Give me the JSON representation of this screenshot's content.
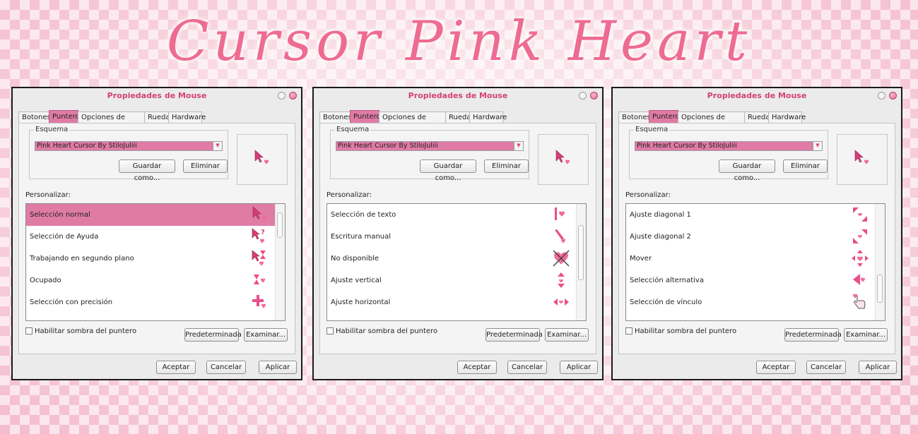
{
  "banner": {
    "title": "Cursor Pink Heart"
  },
  "colors": {
    "accent": "#e07ba6",
    "title_text": "#d4417a",
    "heart": "#e94e8b"
  },
  "dialogs": [
    {
      "title": "Propiedades de Mouse",
      "tabs": [
        "Botones",
        "Punteros",
        "Opciones de puntero",
        "Rueda",
        "Hardware"
      ],
      "active_tab": "Punteros",
      "scheme": {
        "label": "Esquema",
        "value": "Pink Heart Cursor By StiloJuliii",
        "save_as": "Guardar como...",
        "delete": "Eliminar"
      },
      "customize_label": "Personalizar:",
      "list": [
        {
          "label": "Selección normal",
          "icon": "arrow-heart-icon",
          "selected": true
        },
        {
          "label": "Selección de Ayuda",
          "icon": "help-arrow-heart-icon",
          "selected": false
        },
        {
          "label": "Trabajando en segundo plano",
          "icon": "busy-arrow-heart-icon",
          "selected": false
        },
        {
          "label": "Ocupado",
          "icon": "hourglass-heart-icon",
          "selected": false
        },
        {
          "label": "Selección con precisión",
          "icon": "crosshair-heart-icon",
          "selected": false
        }
      ],
      "shadow_label": "Habilitar sombra del puntero",
      "default_button": "Predeterminada",
      "browse_button": "Examinar...",
      "ok": "Aceptar",
      "cancel": "Cancelar",
      "apply": "Aplicar"
    },
    {
      "title": "Propiedades de Mouse",
      "tabs": [
        "Botones",
        "Punteros",
        "Opciones de puntero",
        "Rueda",
        "Hardware"
      ],
      "active_tab": "Punteros",
      "scheme": {
        "label": "Esquema",
        "value": "Pink Heart Cursor By StiloJuliii",
        "save_as": "Guardar como...",
        "delete": "Eliminar"
      },
      "customize_label": "Personalizar:",
      "list": [
        {
          "label": "Selección de texto",
          "icon": "text-beam-heart-icon",
          "selected": false
        },
        {
          "label": "Escritura manual",
          "icon": "pen-heart-icon",
          "selected": false
        },
        {
          "label": "No disponible",
          "icon": "unavailable-heart-icon",
          "selected": false
        },
        {
          "label": "Ajuste vertical",
          "icon": "resize-vertical-icon",
          "selected": false
        },
        {
          "label": "Ajuste horizontal",
          "icon": "resize-horizontal-icon",
          "selected": false
        }
      ],
      "shadow_label": "Habilitar sombra del puntero",
      "default_button": "Predeterminada",
      "browse_button": "Examinar...",
      "ok": "Aceptar",
      "cancel": "Cancelar",
      "apply": "Aplicar"
    },
    {
      "title": "Propiedades de Mouse",
      "tabs": [
        "Botones",
        "Punteros",
        "Opciones de puntero",
        "Rueda",
        "Hardware"
      ],
      "active_tab": "Punteros",
      "scheme": {
        "label": "Esquema",
        "value": "Pink Heart Cursor By StiloJuliii",
        "save_as": "Guardar como...",
        "delete": "Eliminar"
      },
      "customize_label": "Personalizar:",
      "list": [
        {
          "label": "Ajuste diagonal 1",
          "icon": "resize-diagonal-1-icon",
          "selected": false
        },
        {
          "label": "Ajuste diagonal 2",
          "icon": "resize-diagonal-2-icon",
          "selected": false
        },
        {
          "label": "Mover",
          "icon": "move-icon",
          "selected": false
        },
        {
          "label": "Selección alternativa",
          "icon": "alternate-select-icon",
          "selected": false
        },
        {
          "label": "Selección de vínculo",
          "icon": "hand-link-icon",
          "selected": false
        }
      ],
      "shadow_label": "Habilitar sombra del puntero",
      "default_button": "Predeterminada",
      "browse_button": "Examinar...",
      "ok": "Aceptar",
      "cancel": "Cancelar",
      "apply": "Aplicar"
    }
  ]
}
